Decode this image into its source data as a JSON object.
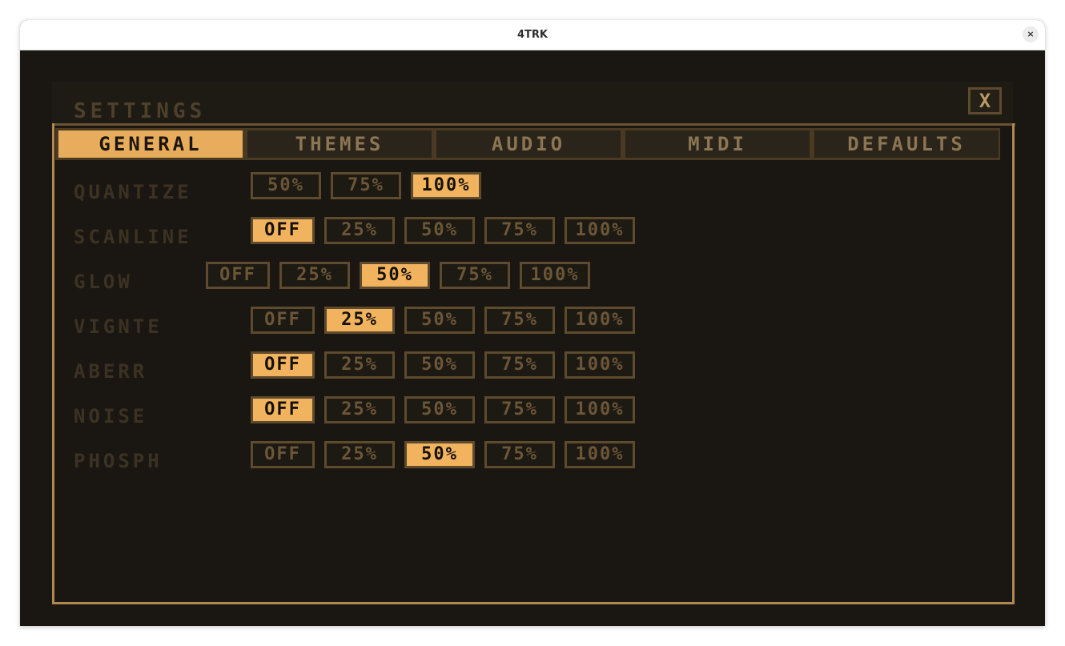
{
  "window": {
    "title": "4TRK",
    "close_label": "×"
  },
  "settings": {
    "title": "SETTINGS",
    "close_label": "X",
    "tabs": [
      {
        "label": "GENERAL",
        "active": true
      },
      {
        "label": "THEMES",
        "active": false
      },
      {
        "label": "AUDIO",
        "active": false
      },
      {
        "label": "MIDI",
        "active": false
      },
      {
        "label": "DEFAULTS",
        "active": false
      }
    ],
    "rows": [
      {
        "label": "QUANTIZE",
        "options": [
          "50%",
          "75%",
          "100%"
        ],
        "selected": "100%"
      },
      {
        "label": "SCANLINE",
        "options": [
          "OFF",
          "25%",
          "50%",
          "75%",
          "100%"
        ],
        "selected": "OFF"
      },
      {
        "label": "GLOW",
        "options": [
          "OFF",
          "25%",
          "50%",
          "75%",
          "100%"
        ],
        "selected": "50%"
      },
      {
        "label": "VIGNTE",
        "options": [
          "OFF",
          "25%",
          "50%",
          "75%",
          "100%"
        ],
        "selected": "25%"
      },
      {
        "label": "ABERR",
        "options": [
          "OFF",
          "25%",
          "50%",
          "75%",
          "100%"
        ],
        "selected": "OFF"
      },
      {
        "label": "NOISE",
        "options": [
          "OFF",
          "25%",
          "50%",
          "75%",
          "100%"
        ],
        "selected": "OFF"
      },
      {
        "label": "PHOSPH",
        "options": [
          "OFF",
          "25%",
          "50%",
          "75%",
          "100%"
        ],
        "selected": "50%"
      }
    ]
  },
  "colors": {
    "accent": "#f2b35e",
    "background": "#1a1712",
    "frame": "#b08850",
    "button_border": "#5e4a2c",
    "label": "#3c3223"
  }
}
